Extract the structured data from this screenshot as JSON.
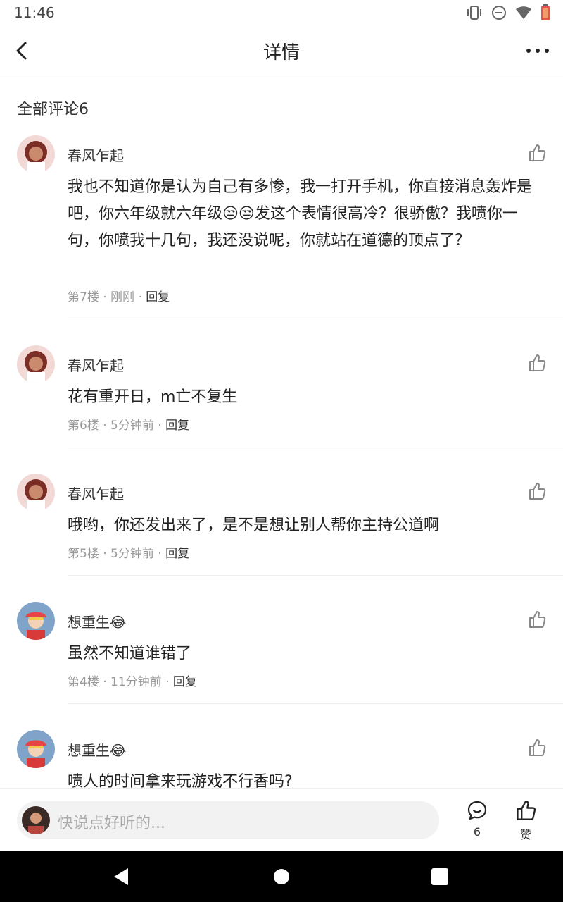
{
  "status_bar": {
    "time": "11:46"
  },
  "header": {
    "title": "详情"
  },
  "section": {
    "title": "全部评论6"
  },
  "comments": [
    {
      "name": "春风乍起",
      "text": "我也不知道你是认为自己有多惨，我一打开手机，你直接消息轰炸是吧，你六年级就六年级😒😒发这个表情很高冷？很骄傲？我喷你一句，你喷我十几句，我还没说呢，你就站在道德的顶点了？",
      "floor": "第7楼",
      "time": "刚刚",
      "reply": "回复"
    },
    {
      "name": "春风乍起",
      "text": "花有重开日，m亡不复生",
      "floor": "第6楼",
      "time": "5分钟前",
      "reply": "回复"
    },
    {
      "name": "春风乍起",
      "text": "哦哟，你还发出来了，是不是想让别人帮你主持公道啊",
      "floor": "第5楼",
      "time": "5分钟前",
      "reply": "回复"
    },
    {
      "name": "想重生😂",
      "text": "虽然不知道谁错了",
      "floor": "第4楼",
      "time": "11分钟前",
      "reply": "回复"
    },
    {
      "name": "想重生😂",
      "text": "喷人的时间拿来玩游戏不行香吗?"
    }
  ],
  "meta_separator": " · ",
  "bottom_bar": {
    "placeholder": "快说点好听的...",
    "comment_count": "6",
    "like_label": "赞"
  },
  "colors": {
    "accent": "#222222",
    "muted": "#999999",
    "divider": "#ececec",
    "input_bg": "#f2f2f2"
  },
  "icons": [
    "back-arrow-icon",
    "more-dots-icon",
    "thumbs-up-icon",
    "comment-bubble-icon",
    "vibrate-icon",
    "dnd-icon",
    "wifi-icon",
    "battery-icon",
    "nav-back-icon",
    "nav-home-icon",
    "nav-recents-icon"
  ]
}
